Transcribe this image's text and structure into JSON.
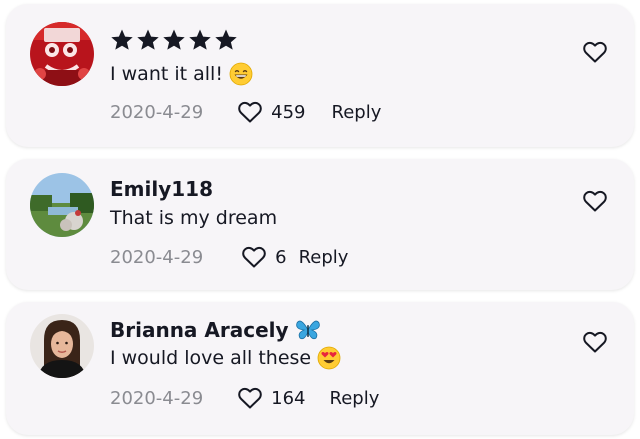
{
  "colors": {
    "card_bg": "#f7f5f8",
    "text": "#161823",
    "date_text": "#8a8b91",
    "star": "#161823",
    "butterfly": "#3aa6e0"
  },
  "comments": [
    {
      "username": "",
      "rating_stars": 5,
      "text": "I want it all!",
      "emoji": "grinning-face-emoji",
      "date": "2020-4-29",
      "likes": "459",
      "reply_label": "Reply",
      "avatar": "red-merchandise-avatar"
    },
    {
      "username": "Emily118",
      "text": "That is my dream",
      "date": "2020-4-29",
      "likes": "6",
      "reply_label": "Reply",
      "avatar": "garden-landscape-avatar"
    },
    {
      "username": "Brianna Aracely",
      "username_badge": "butterfly-icon",
      "text": "I would love all these",
      "emoji": "heart-eyes-emoji",
      "date": "2020-4-29",
      "likes": "164",
      "reply_label": "Reply",
      "avatar": "woman-portrait-avatar"
    }
  ]
}
